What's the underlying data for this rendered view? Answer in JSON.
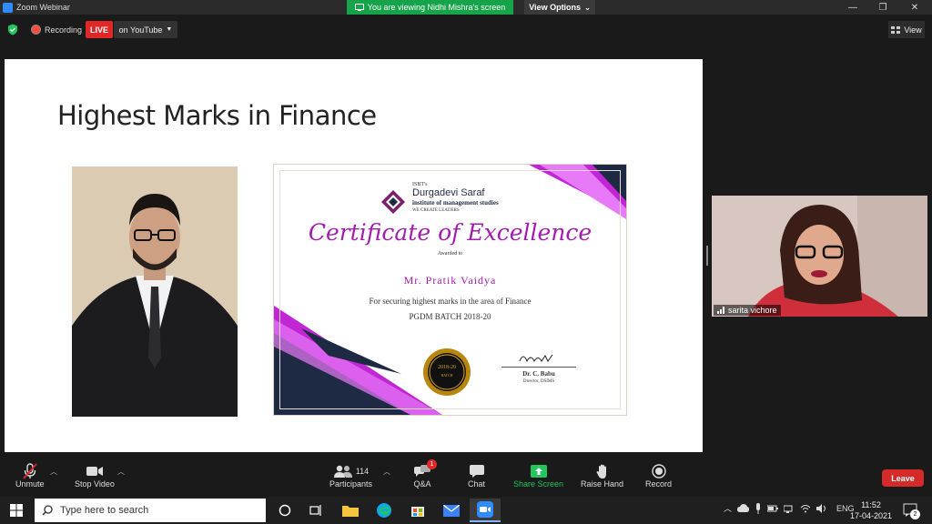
{
  "window": {
    "title": "Zoom Webinar"
  },
  "banner": {
    "viewing_text": "You are viewing Nidhi Mishra's screen",
    "view_options_label": "View Options"
  },
  "topbar": {
    "recording_label": "Recording",
    "live_label": "LIVE",
    "stream_label": "on YouTube",
    "view_label": "View"
  },
  "slide": {
    "title": "Highest Marks in Finance",
    "certificate": {
      "org_prefix": "ISBT's",
      "org_name": "Durgadevi Saraf",
      "org_sub": "institute of management studies",
      "org_tagline": "WE CREATE LEADERS",
      "heading": "Certificate of Excellence",
      "awarded_to": "Awarded to",
      "recipient": "Mr. Pratik Vaidya",
      "reason": "For securing highest marks in the area of Finance",
      "batch": "PGDM BATCH 2018-20",
      "seal_text": "2018-20",
      "seal_sub": "BATCH",
      "signatory": "Dr. C. Babu",
      "signatory_title": "Director, DSIMS"
    }
  },
  "participant": {
    "name": "sarita vichore"
  },
  "toolbar": {
    "unmute_label": "Unmute",
    "stop_video_label": "Stop Video",
    "participants_label": "Participants",
    "participants_count": "114",
    "qa_label": "Q&A",
    "qa_badge": "1",
    "chat_label": "Chat",
    "share_label": "Share Screen",
    "raise_hand_label": "Raise Hand",
    "record_label": "Record",
    "leave_label": "Leave"
  },
  "taskbar": {
    "search_placeholder": "Type here to search",
    "lang": "ENG",
    "time": "11:52",
    "date": "17-04-2021",
    "notifications": "2"
  },
  "colors": {
    "banner_green": "#16a34a",
    "live_red": "#e02828",
    "share_green": "#22c55e",
    "leave_red": "#d42a2a",
    "accent_pink": "#c026d3",
    "accent_navy": "#1e2a44"
  }
}
